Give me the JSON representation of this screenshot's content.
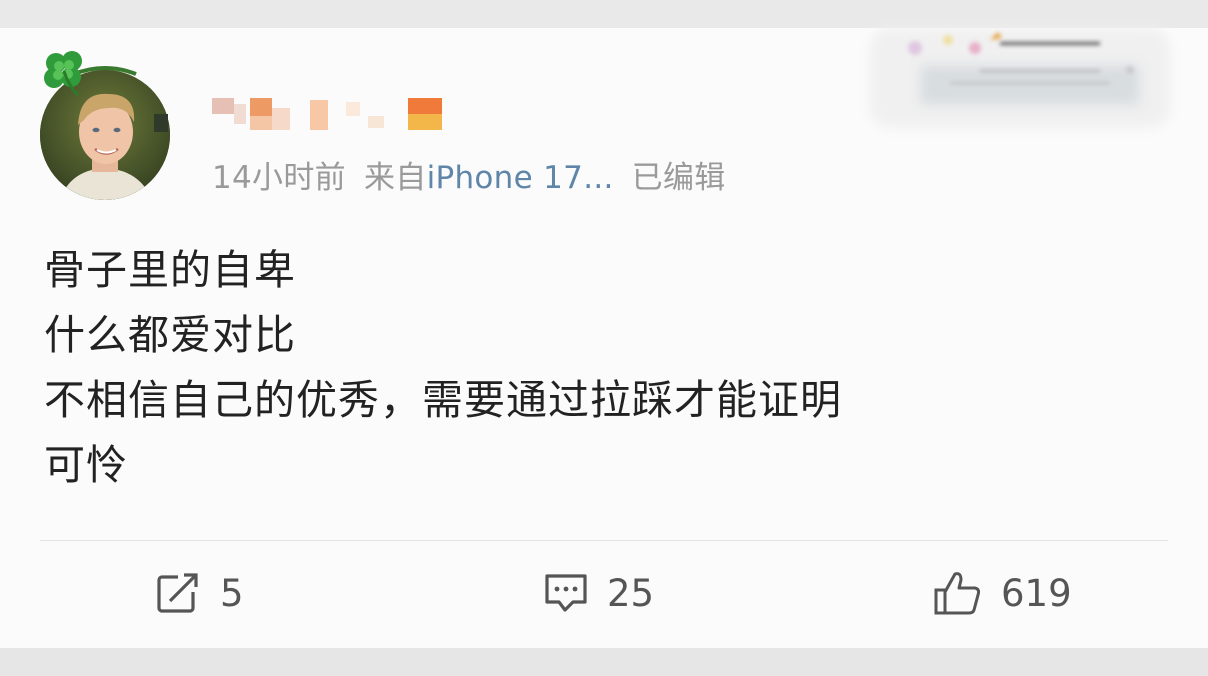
{
  "post": {
    "username_blurred": "",
    "meta": {
      "time": "14小时前",
      "source_prefix": "来自",
      "source": "iPhone 17...",
      "edited": "已编辑"
    },
    "content_lines": [
      "骨子里的自卑",
      "什么都爱对比",
      "不相信自己的优秀，需要通过拉踩才能证明",
      "可怜"
    ]
  },
  "actions": {
    "repost": {
      "icon": "repost-icon",
      "count": "5"
    },
    "comment": {
      "icon": "comment-icon",
      "count": "25"
    },
    "like": {
      "icon": "thumbs-up-icon",
      "count": "619"
    }
  },
  "colors": {
    "source_link": "#5f86a8",
    "meta_text": "#9a9a9a",
    "body_text": "#222222"
  }
}
